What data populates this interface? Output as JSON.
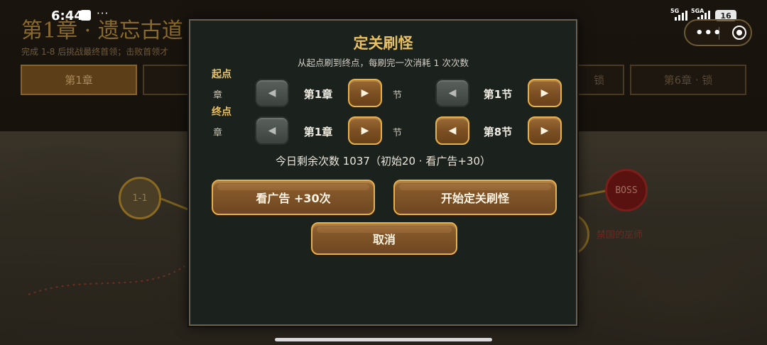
{
  "status_bar": {
    "time": "6:44",
    "dots": "···",
    "net1": "5G",
    "net2": "5GA",
    "battery": "16",
    "miniprogram_dots": "•••"
  },
  "background": {
    "chapter_title": "第1章 · 遗忘古道",
    "chapter_hint": "完成 1-8 后挑战最终首领；击败首领才",
    "tabs": [
      {
        "label": "第1章"
      },
      {
        "label": ""
      },
      {
        "label": "锁"
      },
      {
        "label": "第6章 · 锁"
      }
    ],
    "nodes": {
      "first": "1-1",
      "boss": "BOSS",
      "boss_name": "禁国的巫师"
    }
  },
  "modal": {
    "title": "定关刷怪",
    "description": "从起点刷到终点，每刷完一次消耗 1 次次数",
    "start": {
      "label": "起点",
      "chapter_unit": "章",
      "chapter_value": "第1章",
      "section_unit": "节",
      "section_value": "第1节"
    },
    "end": {
      "label": "终点",
      "chapter_unit": "章",
      "chapter_value": "第1章",
      "section_unit": "节",
      "section_value": "第8节"
    },
    "prev_arrow": "◀",
    "next_arrow": "▶",
    "remaining": "今日剩余次数 1037（初始20 · 看广告+30）",
    "watch_ad_button": "看广告 +30次",
    "start_button": "开始定关刷怪",
    "cancel_button": "取消"
  },
  "colors": {
    "accent_gold": "#e8c060",
    "button_border": "#e8b04a",
    "panel_bg": "#1b221e"
  }
}
